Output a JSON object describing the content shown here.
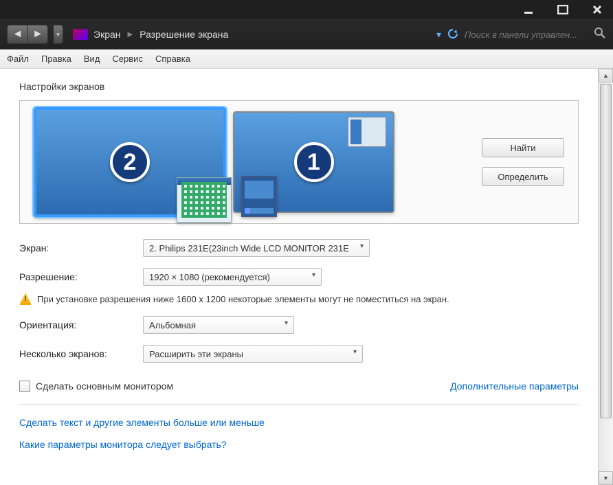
{
  "breadcrumb": {
    "item1": "Экран",
    "item2": "Разрешение экрана"
  },
  "search": {
    "placeholder": "Поиск в панели управлен..."
  },
  "menu": {
    "file": "Файл",
    "edit": "Правка",
    "view": "Вид",
    "service": "Сервис",
    "help": "Справка"
  },
  "section": {
    "title": "Настройки экранов"
  },
  "monitors": {
    "m2": "2",
    "m1": "1"
  },
  "buttons": {
    "find": "Найти",
    "identify": "Определить"
  },
  "form": {
    "display_label": "Экран:",
    "display_value": "2. Philips 231E(23inch Wide LCD MONITOR 231E",
    "resolution_label": "Разрешение:",
    "resolution_value": "1920 × 1080 (рекомендуется)",
    "warning": "При установке разрешения ниже 1600 х 1200 некоторые элементы могут не поместиться на экран.",
    "orientation_label": "Ориентация:",
    "orientation_value": "Альбомная",
    "multi_label": "Несколько экранов:",
    "multi_value": "Расширить эти экраны"
  },
  "checkbox": {
    "label": "Сделать основным монитором"
  },
  "links": {
    "advanced": "Дополнительные параметры",
    "textsize": "Сделать текст и другие элементы больше или меньше",
    "which": "Какие параметры монитора следует выбрать?"
  }
}
